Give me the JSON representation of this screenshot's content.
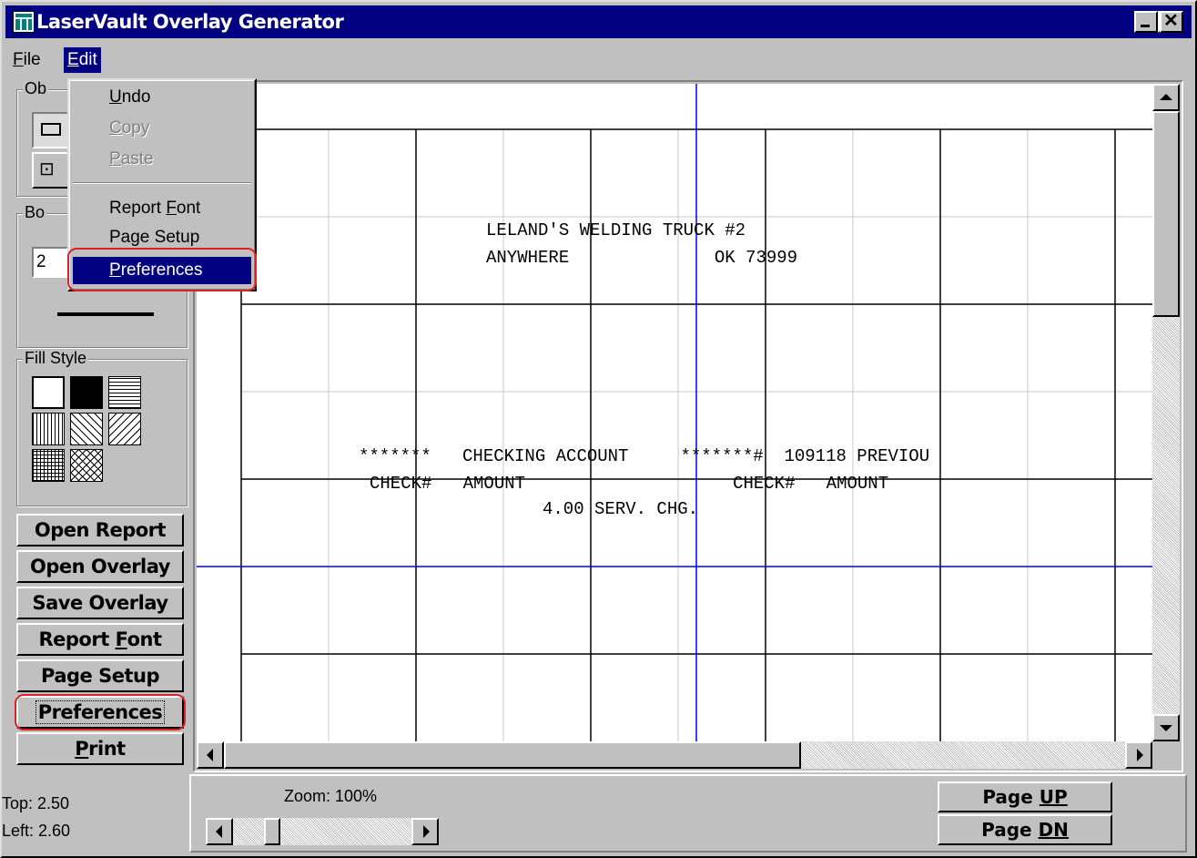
{
  "window": {
    "title": "LaserVault Overlay Generator"
  },
  "menubar": {
    "items": [
      {
        "label": "File",
        "accel": "F",
        "rest": "ile"
      },
      {
        "label": "Edit",
        "accel": "E",
        "rest": "dit"
      }
    ]
  },
  "edit_menu": {
    "undo": {
      "accel": "U",
      "rest": "ndo"
    },
    "copy": {
      "accel": "C",
      "rest": "opy"
    },
    "paste": {
      "accel": "P",
      "rest": "aste"
    },
    "report_font": {
      "pre": "Report ",
      "accel": "F",
      "rest": "ont"
    },
    "page_setup": {
      "label": "Page Setup"
    },
    "preferences": {
      "accel": "P",
      "rest": "references"
    }
  },
  "left_panel": {
    "object_group_label": "Ob",
    "border_group_label": "Bo",
    "border_width_value": "2",
    "fill_style_label": "Fill Style",
    "buttons": {
      "open_report": "Open Report",
      "open_overlay": "Open Overlay",
      "save_overlay": "Save Overlay",
      "report_font_pre": "Report ",
      "report_font_accel": "F",
      "report_font_rest": "ont",
      "page_setup": "Page Setup",
      "preferences": "Preferences",
      "print_accel": "P",
      "print_rest": "rint"
    }
  },
  "report": {
    "lines": [
      "LELAND'S WELDING TRUCK #2",
      "ANYWHERE              OK 73999",
      "*******   CHECKING ACCOUNT     *******#  109118 PREVIOU",
      "CHECK#   AMOUNT                    CHECK#   AMOUNT",
      "4.00 SERV. CHG."
    ]
  },
  "status": {
    "top": "Top: 2.50",
    "left": "Left: 2.60"
  },
  "zoom": {
    "label": "Zoom: 100%",
    "value_percent": 100
  },
  "paging": {
    "up_pre": "Page ",
    "up_accel": "UP",
    "dn_pre": "Page ",
    "dn_accel": "DN"
  },
  "colors": {
    "titlebar": "#000080",
    "grid_line": "#000000",
    "guide_line": "#0000ff",
    "highlight": "#dd2222"
  }
}
